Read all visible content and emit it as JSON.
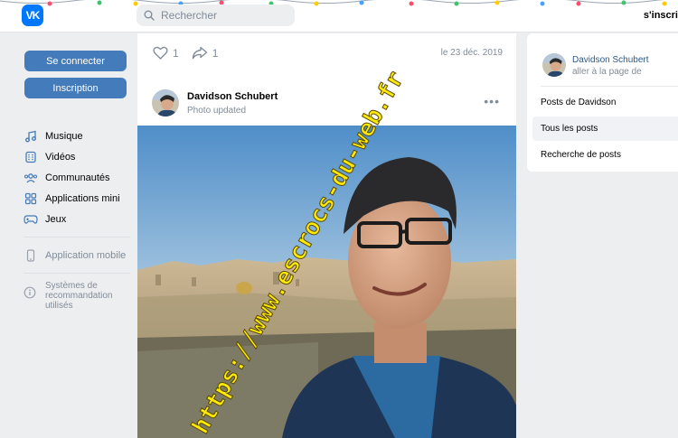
{
  "header": {
    "logo": "VK",
    "search_placeholder": "Rechercher",
    "signup_link": "s'inscri"
  },
  "left": {
    "login_button": "Se connecter",
    "register_button": "Inscription",
    "nav": [
      {
        "label": "Musique",
        "icon": "music-note-icon"
      },
      {
        "label": "Vidéos",
        "icon": "video-icon"
      },
      {
        "label": "Communautés",
        "icon": "communities-icon"
      },
      {
        "label": "Applications mini",
        "icon": "apps-grid-icon"
      },
      {
        "label": "Jeux",
        "icon": "gamepad-icon"
      }
    ],
    "mobile_app": "Application mobile",
    "recommend": "Systèmes de recommandation utilisés"
  },
  "post": {
    "likes": "1",
    "shares": "1",
    "date": "le 23 déc. 2019",
    "author_name": "Davidson Schubert",
    "author_sub": "Photo updated",
    "more": "•••",
    "watermark": "https://www.escrocs-du-web.fr"
  },
  "right": {
    "name": "Davidson Schubert",
    "sub": "aller à la page de",
    "items": [
      {
        "label": "Posts de Davidson"
      },
      {
        "label": "Tous les posts"
      },
      {
        "label": "Recherche de posts"
      }
    ]
  },
  "colors": {
    "brand": "#0077ff",
    "button": "#447bba",
    "link": "#2a5885",
    "muted": "#818c99",
    "watermark": "#ffeb00"
  }
}
